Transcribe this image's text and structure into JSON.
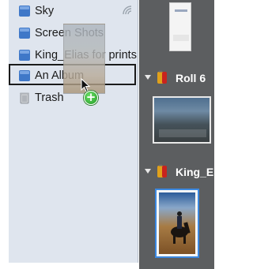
{
  "sidebar": {
    "items": [
      {
        "label": "Sky",
        "icon": "album-icon"
      },
      {
        "label": "Screen Shots",
        "icon": "album-icon"
      },
      {
        "label": "King_Elias for prints",
        "icon": "album-icon"
      },
      {
        "label": "An Album",
        "icon": "album-icon"
      },
      {
        "label": "Trash",
        "icon": "trash-icon"
      }
    ]
  },
  "browser": {
    "rolls": [
      {
        "label": "Roll 6"
      },
      {
        "label": "King_Eli"
      }
    ]
  },
  "colors": {
    "sidebar_bg": "#dfe5ee",
    "browser_bg": "#5c5e60",
    "selection_outline": "#1b1b1b",
    "add_badge": "#1e9a23",
    "thumb_selected_border": "#3b88e0"
  }
}
